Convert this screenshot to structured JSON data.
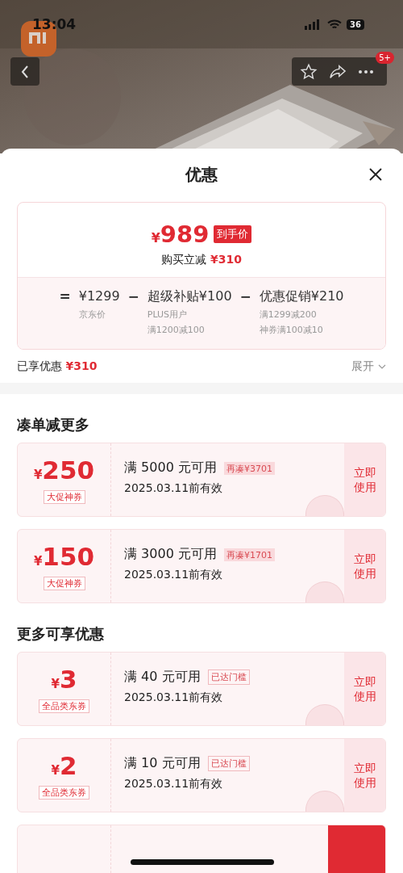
{
  "status_bar": {
    "time": "13:04",
    "battery": "36"
  },
  "nav": {
    "badge": "5+"
  },
  "sheet": {
    "title": "优惠"
  },
  "price_card": {
    "price_symbol": "¥",
    "price": "989",
    "price_tag": "到手价",
    "saving_label": "购买立减",
    "saving": "¥310",
    "equals": "=",
    "terms": [
      {
        "amount": "¥1299",
        "notes": [
          "京东价"
        ]
      },
      {
        "operator": "−",
        "label": "超级补贴",
        "amount": "¥100",
        "notes": [
          "PLUS用户",
          "满1200减100"
        ]
      },
      {
        "operator": "−",
        "label": "优惠促销",
        "amount": "¥210",
        "notes": [
          "满1299减200",
          "神券满100减10"
        ]
      }
    ]
  },
  "enjoyed": {
    "label": "已享优惠",
    "amount": "¥310",
    "expand": "展开"
  },
  "sections": [
    {
      "title": "凑单减更多",
      "coupons": [
        {
          "kind": "full",
          "symbol": "¥",
          "amount": "250",
          "type_label": "大促神券",
          "condition": "满 5000 元可用",
          "tag": {
            "kind": "gap",
            "text": "再凑¥3701"
          },
          "validity": "2025.03.11前有效",
          "stamped": true,
          "action": "立即使用"
        },
        {
          "kind": "full",
          "symbol": "¥",
          "amount": "150",
          "type_label": "大促神券",
          "condition": "满 3000 元可用",
          "tag": {
            "kind": "gap",
            "text": "再凑¥1701"
          },
          "validity": "2025.03.11前有效",
          "stamped": true,
          "action": "立即使用"
        }
      ]
    },
    {
      "title": "更多可享优惠",
      "coupons": [
        {
          "kind": "full",
          "symbol": "¥",
          "amount": "3",
          "type_label": "全品类东券",
          "condition": "满 40 元可用",
          "tag": {
            "kind": "reached",
            "text": "已达门槛"
          },
          "validity": "2025.03.11前有效",
          "stamped": true,
          "action": "立即使用"
        },
        {
          "kind": "full",
          "symbol": "¥",
          "amount": "2",
          "type_label": "全品类东券",
          "condition": "满 10 元可用",
          "tag": {
            "kind": "reached",
            "text": "已达门槛"
          },
          "validity": "2025.03.11前有效",
          "stamped": true,
          "action": "立即使用"
        },
        {
          "kind": "partial"
        }
      ]
    }
  ]
}
